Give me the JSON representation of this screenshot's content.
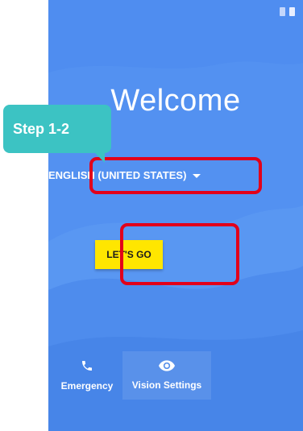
{
  "screen": {
    "title": "Welcome",
    "language_selector": "ENGLISH (UNITED STATES)",
    "primary_button": "LET'S GO",
    "bottom_buttons": [
      {
        "label": "Emergency",
        "icon": "phone-icon"
      },
      {
        "label": "Vision Settings",
        "icon": "eye-icon"
      }
    ],
    "status_icons": [
      "sim-icon",
      "battery-icon"
    ]
  },
  "annotation": {
    "callout_text": "Step 1-2",
    "callout_color": "#3cc3c3",
    "highlight_color": "#e2001a"
  },
  "colors": {
    "background": "#4f8df0",
    "button": "#ffe600"
  }
}
